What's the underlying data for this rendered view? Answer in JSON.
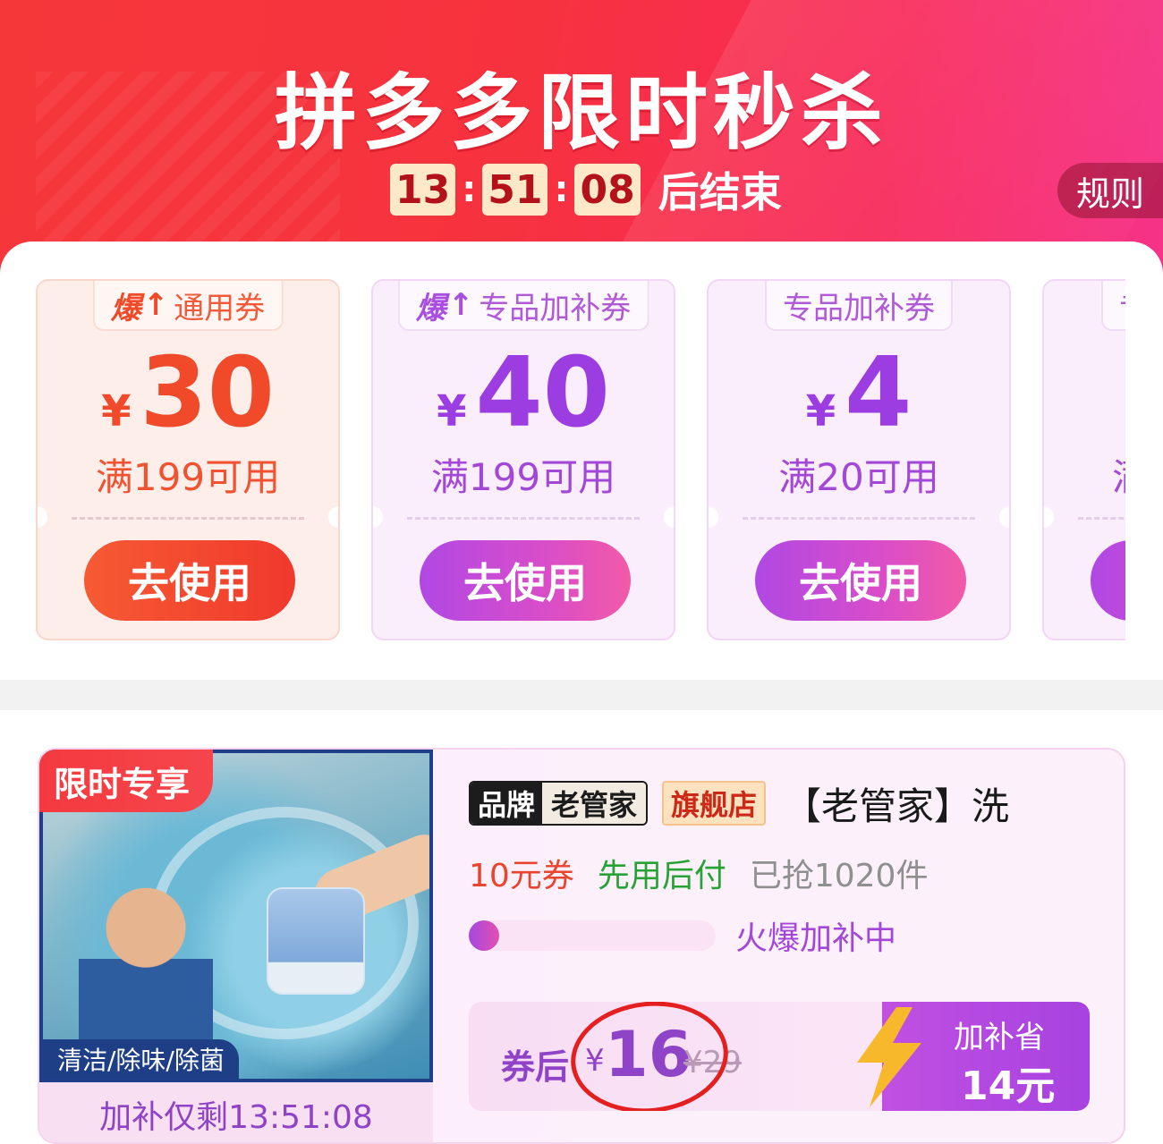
{
  "header": {
    "title": "拼多多限时秒杀",
    "countdown": {
      "hours": "13",
      "minutes": "51",
      "seconds": "08",
      "suffix": "后结束"
    },
    "rules_label": "规则"
  },
  "coupons": [
    {
      "tag_prefix": "爆",
      "tag_label": "通用券",
      "currency": "¥",
      "amount": "30",
      "condition": "满199可用",
      "button_label": "去使用",
      "theme": "red"
    },
    {
      "tag_prefix": "爆",
      "tag_label": "专品加补券",
      "currency": "¥",
      "amount": "40",
      "condition": "满199可用",
      "button_label": "去使用",
      "theme": "purple"
    },
    {
      "tag_prefix": "",
      "tag_label": "专品加补券",
      "currency": "¥",
      "amount": "4",
      "condition": "满20可用",
      "button_label": "去使用",
      "theme": "purple"
    },
    {
      "tag_prefix": "",
      "tag_label": "专",
      "currency": "",
      "amount": "",
      "condition": "满",
      "button_label": "",
      "theme": "purple"
    }
  ],
  "product": {
    "exclusive_badge": "限时专享",
    "image_feature_text": "清洁/除味/除菌",
    "subsidy_timer": "加补仅剩13:51:08",
    "brand_key": "品牌",
    "brand_name": "老管家",
    "store_badge": "旗舰店",
    "title": "【老管家】洗",
    "tags": {
      "coupon": "10元券",
      "pay_later": "先用后付",
      "sold": "已抢1020件"
    },
    "progress": {
      "fraction": 0.08,
      "label": "火爆加补中"
    },
    "price": {
      "after_coupon_label": "券后",
      "currency": "¥",
      "current": "16",
      "original": "¥29",
      "save_line1": "加补省",
      "save_line2": "14元"
    }
  },
  "colors": {
    "header_red": "#f5373a",
    "header_pink": "#f6338a",
    "coupon_red": "#f04a2b",
    "coupon_purple": "#9b3de0",
    "price_purple": "#8f43c7",
    "annotation_circle": "#e31f1f"
  }
}
